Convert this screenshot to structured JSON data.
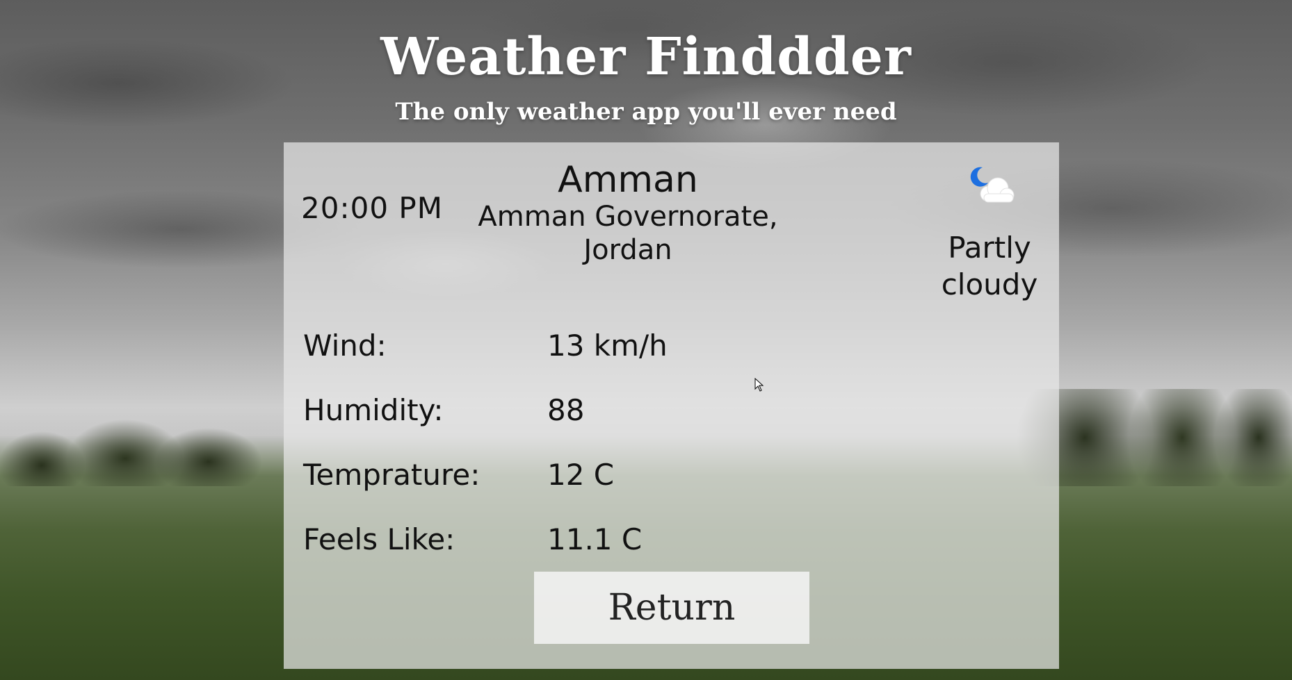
{
  "app": {
    "title": "Weather Finddder",
    "subtitle": "The only weather app you'll ever need"
  },
  "weather": {
    "time": "20:00 PM",
    "city": "Amman",
    "region": "Amman Governorate, Jordan",
    "condition_line1": "Partly",
    "condition_line2": "cloudy",
    "icon": "partly-cloudy-night-icon",
    "details": [
      {
        "label": "Wind:",
        "value": "13 km/h"
      },
      {
        "label": "Humidity:",
        "value": "88"
      },
      {
        "label": "Temprature:",
        "value": "12 C"
      },
      {
        "label": "Feels Like:",
        "value": "11.1 C"
      }
    ]
  },
  "actions": {
    "return_label": "Return"
  },
  "colors": {
    "moon": "#1d6fe0",
    "card": "#e8e8e8",
    "title": "#ffffff"
  }
}
